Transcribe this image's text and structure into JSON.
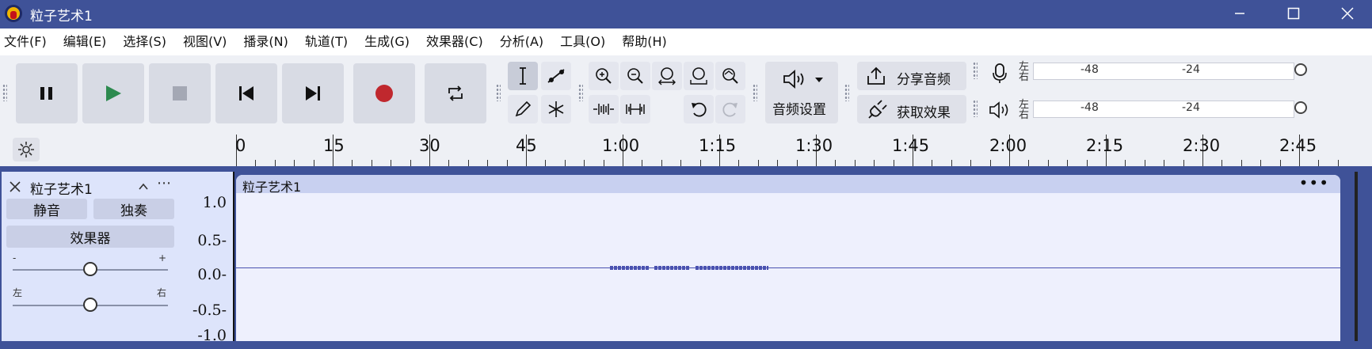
{
  "window": {
    "title": "粒子艺术1",
    "minimize_icon": "minimize-icon",
    "maximize_icon": "maximize-icon",
    "close_icon": "close-icon"
  },
  "menu": [
    "文件(F)",
    "编辑(E)",
    "选择(S)",
    "视图(V)",
    "播录(N)",
    "轨道(T)",
    "生成(G)",
    "效果器(C)",
    "分析(A)",
    "工具(O)",
    "帮助(H)"
  ],
  "toolbar": {
    "transport": [
      "pause-icon",
      "play-icon",
      "stop-icon",
      "skip-to-start-icon",
      "skip-to-end-icon",
      "record-icon",
      "loop-icon"
    ],
    "tools": [
      "selection-tool-icon",
      "envelope-tool-icon",
      "draw-tool-icon",
      "multi-tool-icon"
    ],
    "zoom": [
      "zoom-in-icon",
      "zoom-out-icon",
      "fit-selection-icon",
      "fit-project-icon",
      "zoom-toggle-icon",
      "trim-outside-icon",
      "silence-selection-icon",
      "undo-icon",
      "redo-icon"
    ],
    "audio_setup_label": "音频设置",
    "share_audio_label": "分享音频",
    "get_effects_label": "获取效果",
    "meter_left": "左",
    "meter_right": "右",
    "meter_db_1": "-48",
    "meter_db_2": "-24"
  },
  "ruler": {
    "labels": [
      "0",
      "15",
      "30",
      "45",
      "1:00",
      "1:15",
      "1:30",
      "1:45",
      "2:00",
      "2:15",
      "2:30",
      "2:45"
    ]
  },
  "track": {
    "name": "粒子艺术1",
    "mute_label": "静音",
    "solo_label": "独奏",
    "effects_label": "效果器",
    "gain_minus": "-",
    "gain_plus": "+",
    "pan_left": "左",
    "pan_right": "右",
    "gain_value": 0.5,
    "pan_value": 0.5,
    "clip_name": "粒子艺术1",
    "clip_menu": "•••",
    "scale": [
      "1.0",
      "0.5-",
      "0.0-",
      "-0.5-",
      "-1.0"
    ]
  },
  "colors": {
    "titlebar": "#3f5298",
    "waveform": "#4a52b0",
    "record": "#c0282e",
    "play": "#2d8a4f"
  }
}
